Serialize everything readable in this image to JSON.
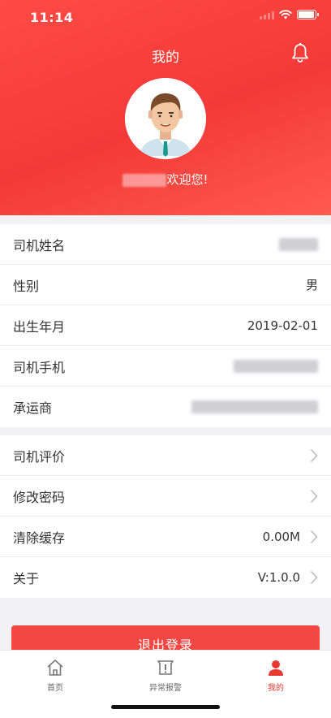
{
  "status_bar": {
    "time": "11:14"
  },
  "header": {
    "title": "我的",
    "welcome_suffix": "欢迎您!"
  },
  "info_rows": [
    {
      "label": "司机姓名",
      "value": ""
    },
    {
      "label": "性别",
      "value": "男"
    },
    {
      "label": "出生年月",
      "value": "2019-02-01"
    },
    {
      "label": "司机手机",
      "value": ""
    },
    {
      "label": "承运商",
      "value": ""
    }
  ],
  "menu_rows": [
    {
      "label": "司机评价",
      "value": ""
    },
    {
      "label": "修改密码",
      "value": ""
    },
    {
      "label": "清除缓存",
      "value": "0.00M"
    },
    {
      "label": "关于",
      "value": "V:1.0.0"
    }
  ],
  "logout_label": "退出登录",
  "tabbar": [
    {
      "label": "首页",
      "icon": "home-icon"
    },
    {
      "label": "异常报警",
      "icon": "alarm-icon"
    },
    {
      "label": "我的",
      "icon": "profile-icon",
      "active": true
    }
  ],
  "colors": {
    "primary": "#f34743",
    "active_tab": "#e8382f"
  }
}
